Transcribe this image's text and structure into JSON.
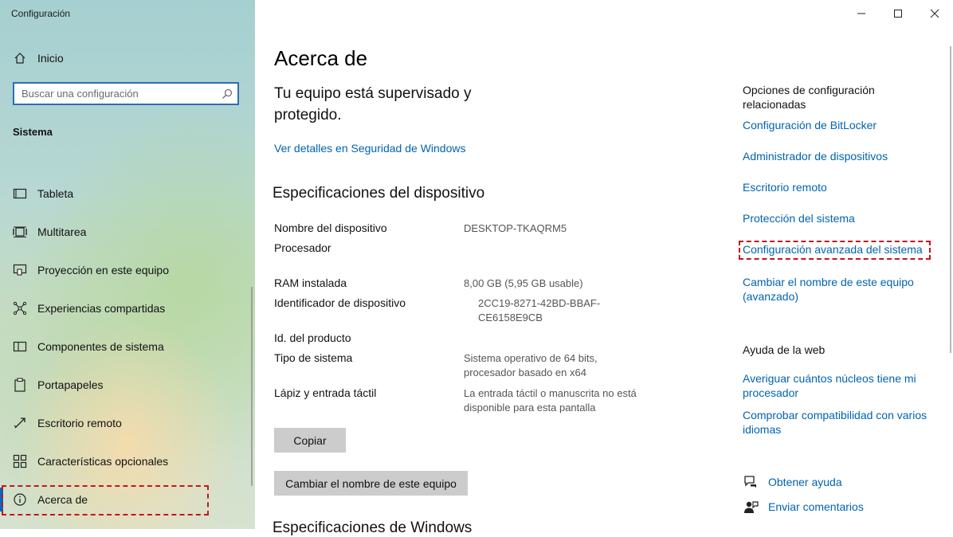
{
  "window": {
    "title": "Configuración"
  },
  "sidebar": {
    "home_label": "Inicio",
    "search_placeholder": "Buscar una configuración",
    "section_label": "Sistema",
    "items": [
      {
        "label": "Tableta",
        "icon": "tablet-icon"
      },
      {
        "label": "Multitarea",
        "icon": "multitask-icon"
      },
      {
        "label": "Proyección en este equipo",
        "icon": "projection-icon"
      },
      {
        "label": "Experiencias compartidas",
        "icon": "shared-experiences-icon"
      },
      {
        "label": "Componentes de sistema",
        "icon": "system-components-icon"
      },
      {
        "label": "Portapapeles",
        "icon": "clipboard-icon"
      },
      {
        "label": "Escritorio remoto",
        "icon": "remote-desktop-icon"
      },
      {
        "label": "Características opcionales",
        "icon": "optional-features-icon"
      },
      {
        "label": "Acerca de",
        "icon": "info-icon",
        "active": true
      }
    ]
  },
  "main": {
    "title": "Acerca de",
    "protection_title": "Tu equipo está supervisado y protegido.",
    "security_link": "Ver detalles en Seguridad de Windows",
    "specs_title": "Especificaciones del dispositivo",
    "specs": [
      {
        "label": "Nombre del dispositivo",
        "value": "DESKTOP-TKAQRM5"
      },
      {
        "label": "Procesador",
        "value": ""
      },
      {
        "label": "RAM instalada",
        "value": "8,00 GB (5,95 GB usable)"
      },
      {
        "label": "Identificador de dispositivo",
        "value": "2CC19-8271-42BD-BBAF-CE6158E9CB"
      },
      {
        "label": "Id. del producto",
        "value": ""
      },
      {
        "label": "Tipo de sistema",
        "value": "Sistema operativo de 64 bits, procesador basado en x64"
      },
      {
        "label": "Lápiz y entrada táctil",
        "value": "La entrada táctil o manuscrita no está disponible para esta pantalla"
      }
    ],
    "copy_button": "Copiar",
    "rename_button": "Cambiar el nombre de este equipo",
    "windows_specs_title": "Especificaciones de Windows"
  },
  "related": {
    "heading": "Opciones de configuración relacionadas",
    "links": [
      "Configuración de BitLocker",
      "Administrador de dispositivos",
      "Escritorio remoto",
      "Protección del sistema",
      "Configuración avanzada del sistema",
      "Cambiar el nombre de este equipo (avanzado)"
    ]
  },
  "web_help": {
    "heading": "Ayuda de la web",
    "links": [
      "Averiguar cuántos núcleos tiene mi procesador",
      "Comprobar compatibilidad con varios idiomas"
    ]
  },
  "support": {
    "get_help": "Obtener ayuda",
    "feedback": "Enviar comentarios"
  },
  "colors": {
    "accent": "#0063b1",
    "highlight_dashed": "#c4161c",
    "button_bg": "#cccccc"
  }
}
